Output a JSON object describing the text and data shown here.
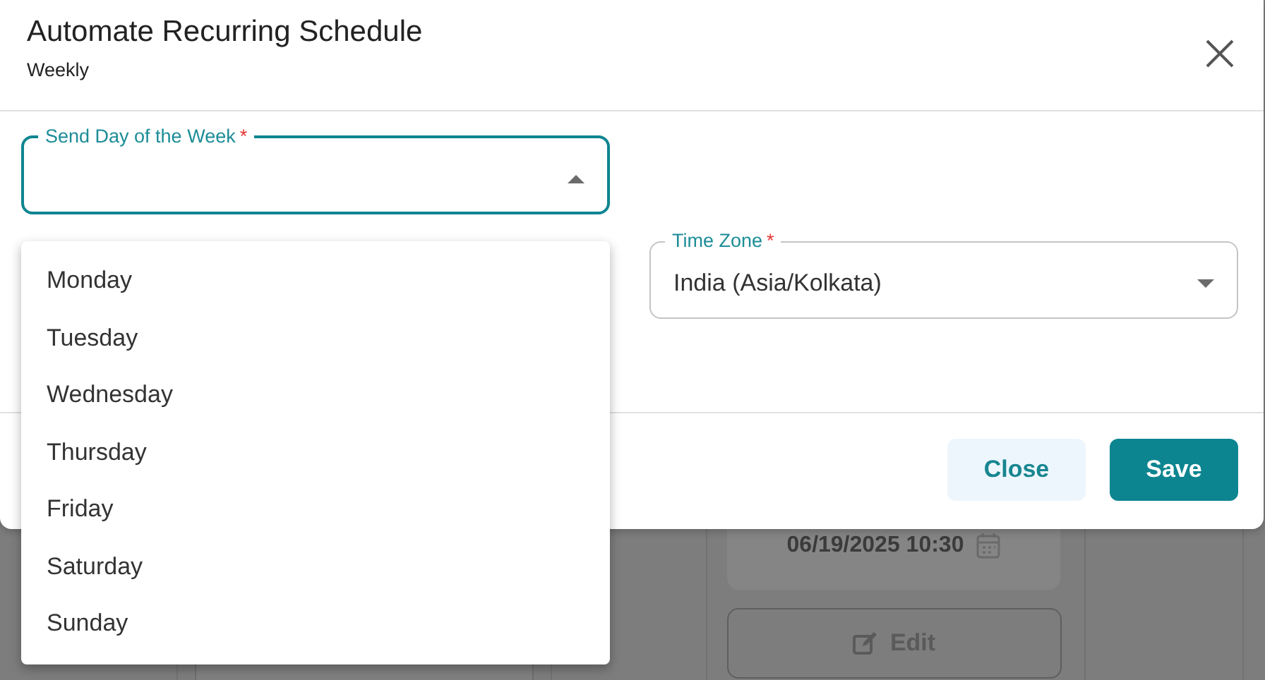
{
  "dialog": {
    "title": "Automate Recurring Schedule",
    "subtitle": "Weekly"
  },
  "fields": [
    {
      "label": "Send Day of the Week",
      "required_mark": "*",
      "focused": true,
      "expanded": true
    },
    {
      "label": "Time Zone",
      "required_mark": "*",
      "focused": false,
      "expanded": false,
      "value": "India (Asia/Kolkata)"
    }
  ],
  "dropdown": {
    "options": [
      {
        "label": "Monday",
        "selected": false
      },
      {
        "label": "Tuesday",
        "selected": false
      },
      {
        "label": "Wednesday",
        "selected": false
      },
      {
        "label": "Thursday",
        "selected": false
      },
      {
        "label": "Friday",
        "selected": false
      },
      {
        "label": "Saturday",
        "selected": false
      },
      {
        "label": "Sunday",
        "selected": false
      }
    ]
  },
  "buttons": [
    {
      "label": "Close",
      "kind": "secondary"
    },
    {
      "label": "Save",
      "kind": "primary"
    }
  ],
  "background": {
    "date_value": "06/19/2025 10:30",
    "edit_label": "Edit"
  }
}
